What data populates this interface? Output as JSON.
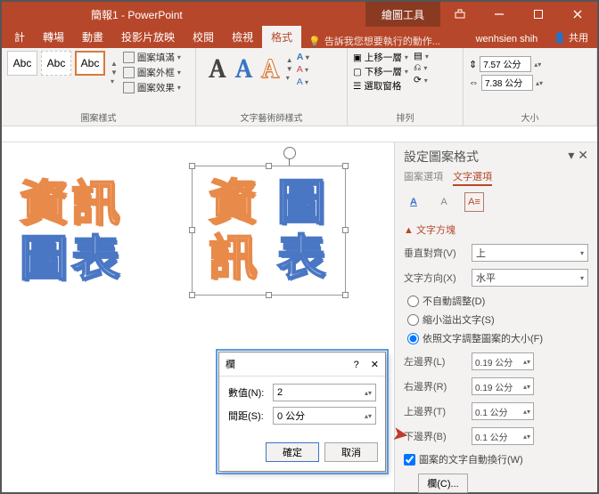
{
  "titlebar": {
    "doc_title": "簡報1 - PowerPoint",
    "context_tab": "繪圖工具"
  },
  "winbtns": {
    "min": "—",
    "max": "▢",
    "close": "✕"
  },
  "tabs": {
    "t1": "計",
    "t2": "轉場",
    "t3": "動畫",
    "t4": "投影片放映",
    "t5": "校閱",
    "t6": "檢視",
    "t7": "格式"
  },
  "tellme": {
    "placeholder": "告訴我您想要執行的動作..."
  },
  "user": {
    "name": "wenhsien shih"
  },
  "share": {
    "label": "共用"
  },
  "ribbon": {
    "shape_styles": {
      "label": "圖案樣式",
      "abc": "Abc",
      "fill": "圖案填滿",
      "outline": "圖案外框",
      "effects": "圖案效果"
    },
    "wordart": {
      "label": "文字藝術師樣式",
      "a": "A",
      "fill": "A",
      "outline": "A",
      "effects": "A"
    },
    "arrange": {
      "label": "排列",
      "forward": "上移一層",
      "backward": "下移一層",
      "selection": "選取窗格",
      "align": "▤",
      "group": "⎌",
      "rotate": "⟳"
    },
    "size": {
      "label": "大小",
      "height": "7.57 公分",
      "width": "7.38 公分"
    }
  },
  "canvas": {
    "left_line1_a": "資",
    "left_line1_b": "訊",
    "left_line2_a": "圖",
    "left_line2_b": "表",
    "right_line1_a": "資",
    "right_line1_b": "圖",
    "right_line2_a": "訊",
    "right_line2_b": "表"
  },
  "dlg": {
    "title": "欄",
    "help": "?",
    "close": "✕",
    "count_label": "數值(N):",
    "count_val": "2",
    "spacing_label": "間距(S):",
    "spacing_val": "0 公分",
    "ok": "確定",
    "cancel": "取消"
  },
  "pane": {
    "title": "設定圖案格式",
    "tab_shape": "圖案選項",
    "tab_text": "文字選項",
    "section": "文字方塊",
    "valign_label": "垂直對齊(V)",
    "valign_val": "上",
    "direction_label": "文字方向(X)",
    "direction_val": "水平",
    "r1": "不自動調整(D)",
    "r2": "縮小溢出文字(S)",
    "r3": "依照文字調整圖案的大小(F)",
    "ml": "左邊界(L)",
    "ml_v": "0.19 公分",
    "mr": "右邊界(R)",
    "mr_v": "0.19 公分",
    "mt": "上邊界(T)",
    "mt_v": "0.1 公分",
    "mb": "下邊界(B)",
    "mb_v": "0.1 公分",
    "wrap": "圖案的文字自動換行(W)",
    "columns": "欄(C)..."
  }
}
